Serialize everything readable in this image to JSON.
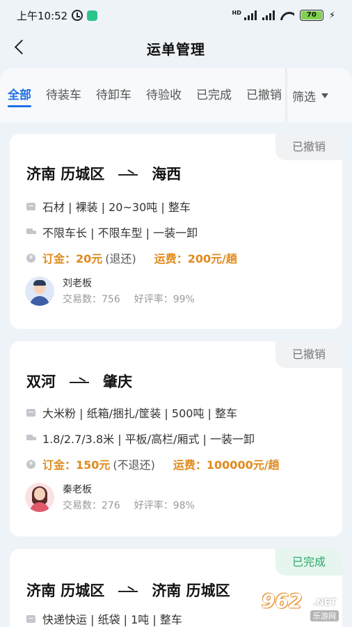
{
  "status_bar": {
    "time": "上午10:52",
    "hd": "HD",
    "battery": "70"
  },
  "header": {
    "title": "运单管理"
  },
  "tabs": [
    {
      "label": "全部",
      "active": true
    },
    {
      "label": "待装车"
    },
    {
      "label": "待卸车"
    },
    {
      "label": "待验收"
    },
    {
      "label": "已完成"
    },
    {
      "label": "已撤销"
    }
  ],
  "filter": {
    "label": "筛选"
  },
  "orders": [
    {
      "status": "已撤销",
      "route_from": "济南 历城区",
      "route_to": "海西",
      "goods": "石材 | 裸装 | 20~30吨 | 整车",
      "vehicle": "不限车长 | 不限车型 | 一装一卸",
      "deposit": "订金：20元",
      "deposit_note": "(退还)",
      "freight": "运费：200元/趟",
      "owner_name": "刘老板",
      "trades": "交易数：756",
      "rating": "好评率：99%"
    },
    {
      "status": "已撤销",
      "route_from": "双河",
      "route_to": "肇庆",
      "goods": "大米粉 | 纸箱/捆扎/筐装 | 500吨 | 整车",
      "vehicle": "1.8/2.7/3.8米 | 平板/高栏/厢式 | 一装一卸",
      "deposit": "订金：150元",
      "deposit_note": "(不退还)",
      "freight": "运费：100000元/趟",
      "owner_name": "秦老板",
      "trades": "交易数：276",
      "rating": "好评率：98%"
    },
    {
      "status": "已完成",
      "route_from": "济南 历城区",
      "route_to": "济南 历城区",
      "goods": "快递快运 | 纸袋 | 1吨 | 整车"
    }
  ],
  "watermark": {
    "logo": "962",
    "net": ".NET",
    "cn": "乐游网"
  },
  "colors": {
    "accent": "#1f6fe8",
    "price": "#e08a1d",
    "done": "#28a869"
  }
}
